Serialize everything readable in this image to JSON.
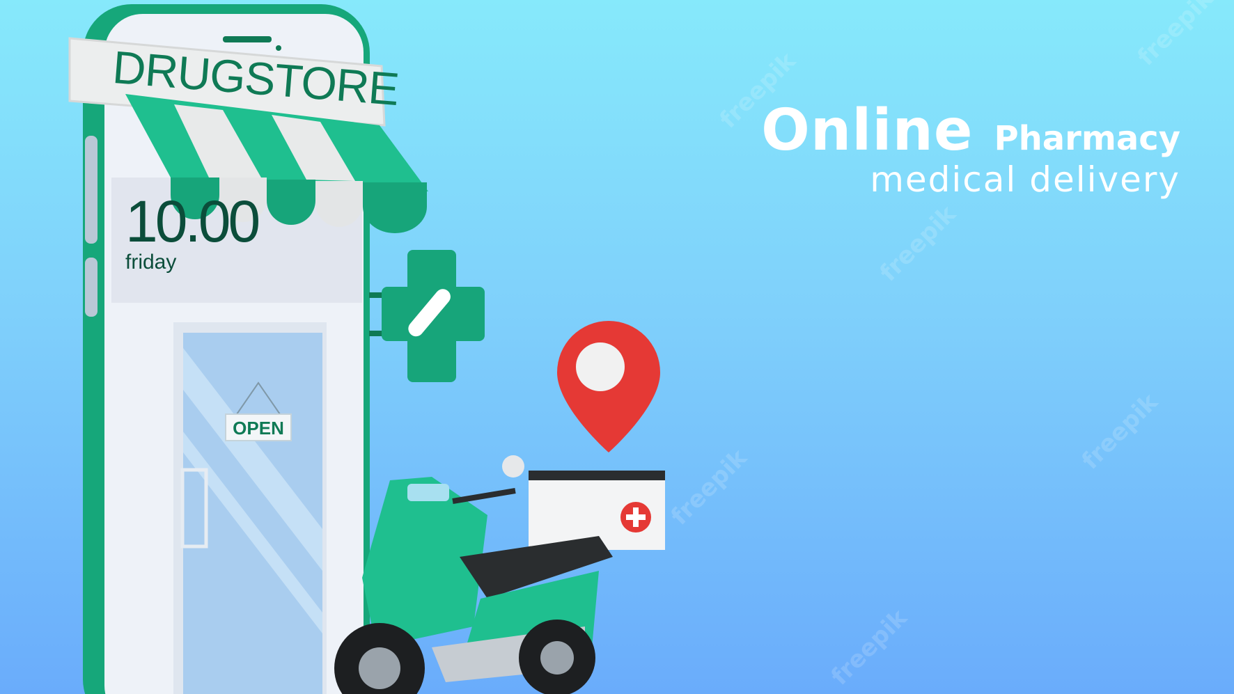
{
  "store_sign": "DRUGSTORE",
  "phone_screen": {
    "time": "10.00",
    "day": "friday"
  },
  "door_sign": "OPEN",
  "headline": {
    "line1_big": "Online",
    "line1_small": "Pharmacy",
    "line2": "medical delivery"
  },
  "watermark": "freepik",
  "colors": {
    "brand_green": "#1fbf8f",
    "dark_green": "#0f7a55",
    "pin_red": "#e53935",
    "bg_top": "#86e9fb",
    "bg_bottom": "#6aacfb"
  }
}
